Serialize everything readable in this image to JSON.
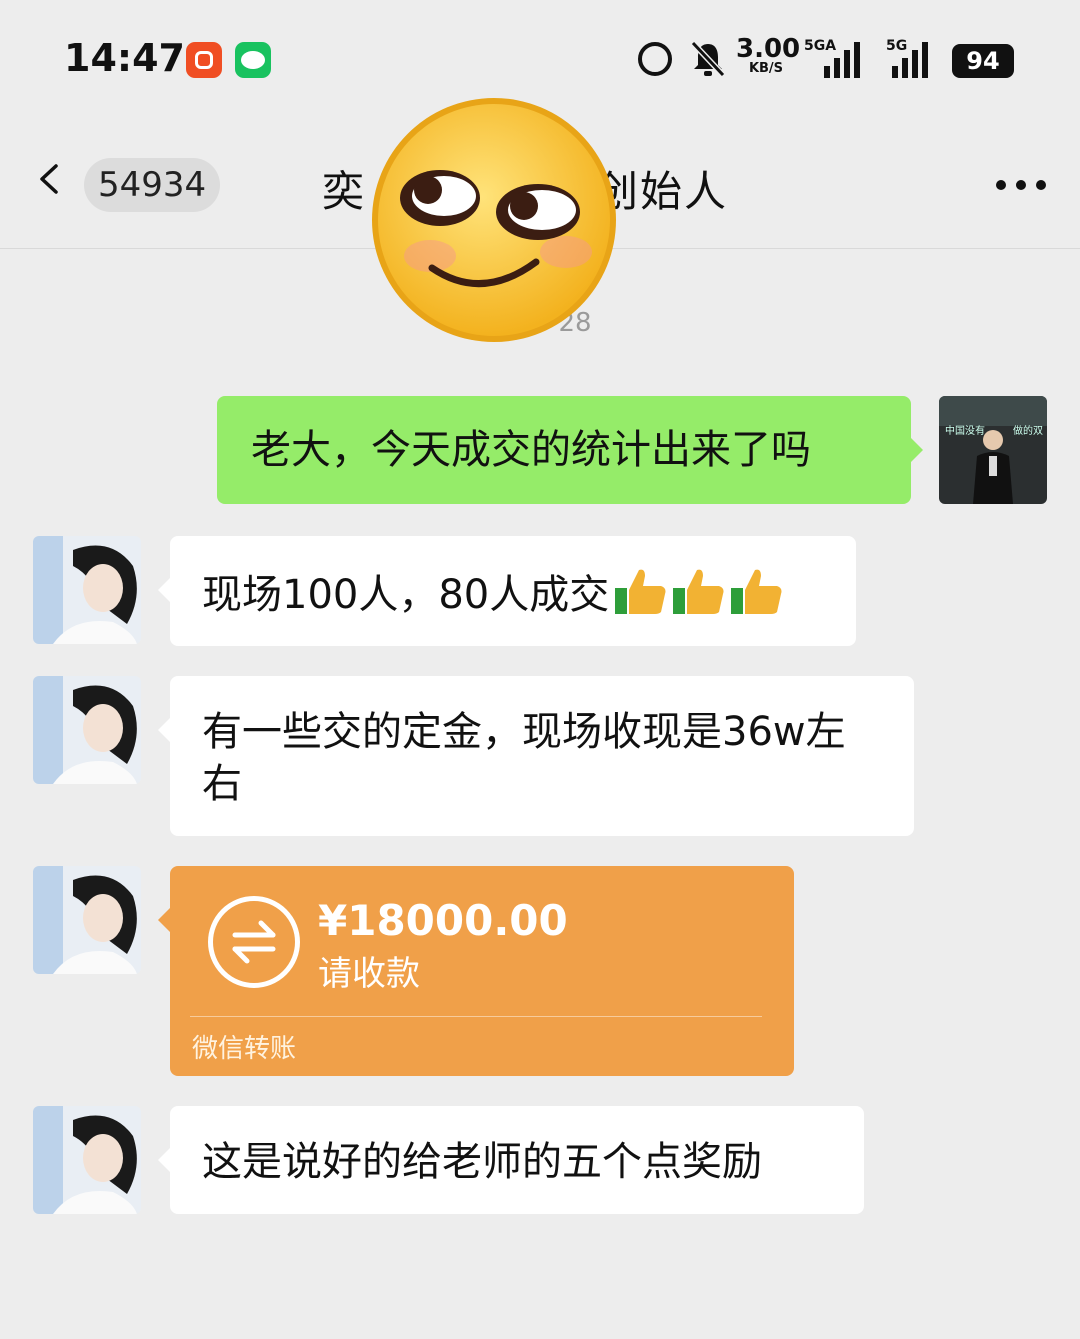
{
  "status_bar": {
    "time": "14:47",
    "net_speed": "3.00",
    "net_speed_unit": "KB/S",
    "sim1_label": "5GA",
    "sim2_label": "5G",
    "battery": "94"
  },
  "header": {
    "unread_count": "54934",
    "title": "奕",
    "title_right": "创始人"
  },
  "timestamp": "28",
  "messages": [
    {
      "side": "out",
      "text": "老大，今天成交的统计出来了吗"
    },
    {
      "side": "in",
      "text": "现场100人，80人成交"
    },
    {
      "side": "in",
      "text": "有一些交的定金，现场收现是36w左右"
    },
    {
      "side": "in",
      "type": "transfer",
      "amount": "¥18000.00",
      "status": "请收款",
      "footer": "微信转账"
    },
    {
      "side": "in",
      "text": "这是说好的给老师的五个点奖励"
    }
  ],
  "colors": {
    "background": "#ededed",
    "outgoing_bubble": "#95ec69",
    "incoming_bubble": "#ffffff",
    "transfer_card": "#f0a049"
  }
}
